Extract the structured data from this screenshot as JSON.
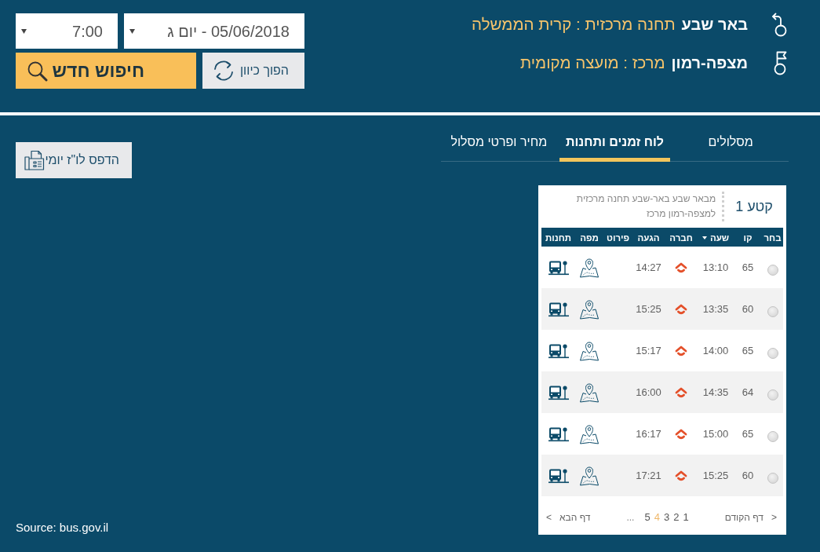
{
  "route": {
    "origin": {
      "city": "באר שבע",
      "station": "תחנה מרכזית : קרית הממשלה"
    },
    "destination": {
      "city": "מצפה-רמון",
      "station": "מרכז : מועצה מקומית"
    }
  },
  "search_form": {
    "date_select": {
      "value": "05/06/2018 - יום ג"
    },
    "time_select": {
      "value": "7:00"
    },
    "reverse_button": {
      "label": "הפוך כיוון"
    },
    "search_button": {
      "label": "חיפוש חדש"
    }
  },
  "tabs": [
    {
      "label": "מסלולים",
      "selected": false
    },
    {
      "label": "לוח זמנים ותחנות",
      "selected": true
    },
    {
      "label": "מחיר ופרטי מסלול",
      "selected": false
    }
  ],
  "print_button": {
    "label": "הדפס לו\"ז יומי"
  },
  "segment": {
    "title": "קטע 1",
    "from": "מבאר שבע באר-שבע תחנה מרכזית",
    "to": "למצפה-רמון מרכז"
  },
  "table": {
    "columns": [
      {
        "label": "בחר",
        "sorted": false
      },
      {
        "label": "קו",
        "sorted": false
      },
      {
        "label": "שעה",
        "sorted": true
      },
      {
        "label": "חברה",
        "sorted": false
      },
      {
        "label": "הגעה",
        "sorted": false
      },
      {
        "label": "פירוט",
        "sorted": false
      },
      {
        "label": "מפה",
        "sorted": false
      },
      {
        "label": "תחנות",
        "sorted": false
      }
    ],
    "rows": [
      {
        "selected": false,
        "line": "65",
        "departure": "13:10",
        "arrival": "14:27"
      },
      {
        "selected": false,
        "line": "60",
        "departure": "13:35",
        "arrival": "15:25"
      },
      {
        "selected": false,
        "line": "65",
        "departure": "14:00",
        "arrival": "15:17"
      },
      {
        "selected": false,
        "line": "64",
        "departure": "14:35",
        "arrival": "16:00"
      },
      {
        "selected": false,
        "line": "65",
        "departure": "15:00",
        "arrival": "16:17"
      },
      {
        "selected": false,
        "line": "60",
        "departure": "15:25",
        "arrival": "17:21"
      }
    ]
  },
  "pagination": {
    "previous": {
      "arrow": ">",
      "label": "דף הקודם"
    },
    "pages": [
      {
        "label": "1",
        "selected": false
      },
      {
        "label": "2",
        "selected": false
      },
      {
        "label": "3",
        "selected": false
      },
      {
        "label": "4",
        "selected": true
      },
      {
        "label": "5",
        "selected": false
      }
    ],
    "ellipsis": "...",
    "next": {
      "arrow": "<",
      "label": "דף הבא"
    }
  },
  "source_note": "Source: bus.gov.il"
}
